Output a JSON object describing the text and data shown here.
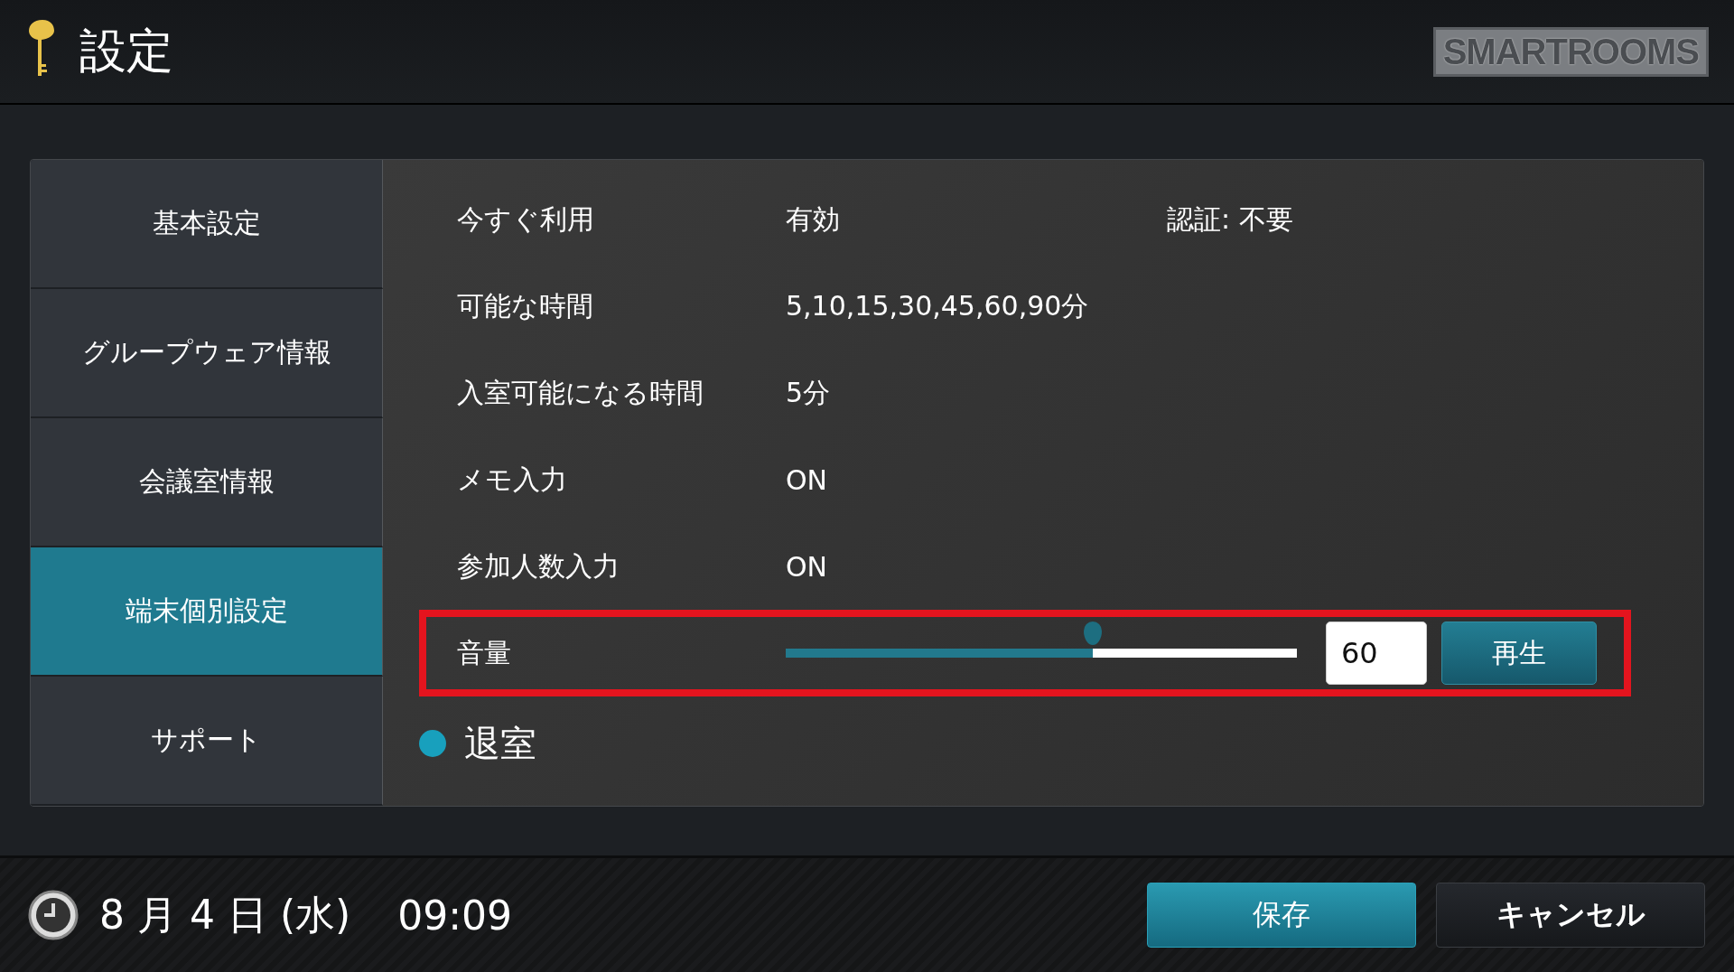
{
  "header": {
    "title": "設定",
    "logo": "SMARTROOMS"
  },
  "sidebar": {
    "items": [
      {
        "label": "基本設定",
        "selected": false
      },
      {
        "label": "グループウェア情報",
        "selected": false
      },
      {
        "label": "会議室情報",
        "selected": false
      },
      {
        "label": "端末個別設定",
        "selected": true
      },
      {
        "label": "サポート",
        "selected": false
      }
    ]
  },
  "settings": [
    {
      "kind": "text",
      "label": "今すぐ利用",
      "value": "有効",
      "note": "認証: 不要"
    },
    {
      "kind": "text",
      "label": "可能な時間",
      "value": "5,10,15,30,45,60,90分"
    },
    {
      "kind": "text",
      "label": "入室可能になる時間",
      "value": "5分"
    },
    {
      "kind": "text",
      "label": "メモ入力",
      "value": "ON"
    },
    {
      "kind": "text",
      "label": "参加人数入力",
      "value": "ON"
    },
    {
      "kind": "volume",
      "label": "音量",
      "level": 0.6,
      "value": "60",
      "button": "再生",
      "highlighted": true
    }
  ],
  "section": {
    "title": "退室"
  },
  "footer": {
    "date": "8 月 4 日 (水)",
    "time": "09:09",
    "buttons": [
      {
        "label": "保存",
        "kind": "primary"
      },
      {
        "label": "キャンセル",
        "kind": "secondary"
      }
    ]
  }
}
